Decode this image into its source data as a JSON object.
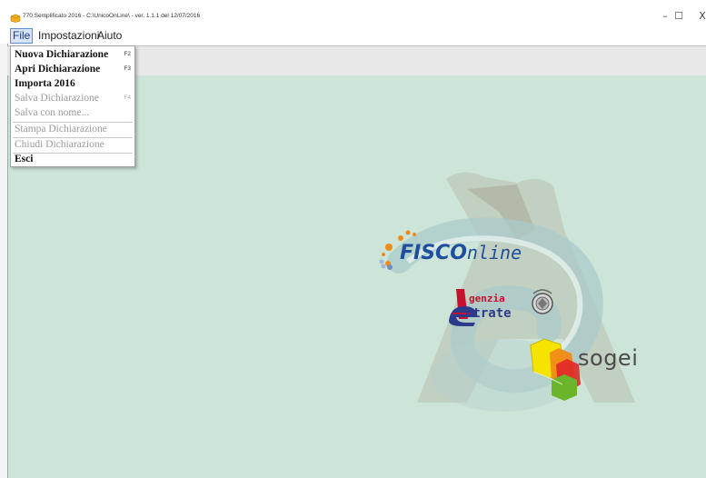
{
  "window": {
    "title": "770 Semplificato 2016 - C:\\UnicoOnLine\\ - ver. 1.1.1 del 12/07/2016",
    "minimize_glyph": "–",
    "maximize_glyph": "☐",
    "close_glyph": "X"
  },
  "menubar": {
    "items": [
      {
        "label": "File",
        "active": true
      },
      {
        "label": "Impostazioni",
        "active": false
      },
      {
        "label": "Aiuto",
        "active": false
      }
    ]
  },
  "file_menu": {
    "items": [
      {
        "label": "Nuova Dichiarazione",
        "shortcut": "F2",
        "enabled": true
      },
      {
        "label": "Apri Dichiarazione",
        "shortcut": "F3",
        "enabled": true
      },
      {
        "label": "Importa 2016",
        "shortcut": "",
        "enabled": true
      },
      {
        "label": "Salva Dichiarazione",
        "shortcut": "F4",
        "enabled": false
      },
      {
        "label": "Salva con nome...",
        "shortcut": "",
        "enabled": false
      },
      {
        "label": "Stampa Dichiarazione",
        "shortcut": "",
        "enabled": false
      },
      {
        "label": "Chiudi Dichiarazione",
        "shortcut": "",
        "enabled": false
      },
      {
        "label": "Esci",
        "shortcut": "",
        "enabled": true
      }
    ]
  },
  "logos": {
    "fisco": {
      "part1": "FISCO",
      "part2": "nline"
    },
    "agenzia": {
      "line1": "genzia",
      "line2": "ntrate"
    },
    "sogei": "sogei"
  },
  "colors": {
    "client_bg": "#cde5d8",
    "fisco_blue": "#1f4e9e",
    "fisco_orange": "#f08a18",
    "agenzia_red": "#c8102e",
    "sogei_gray": "#4a4a4a"
  }
}
